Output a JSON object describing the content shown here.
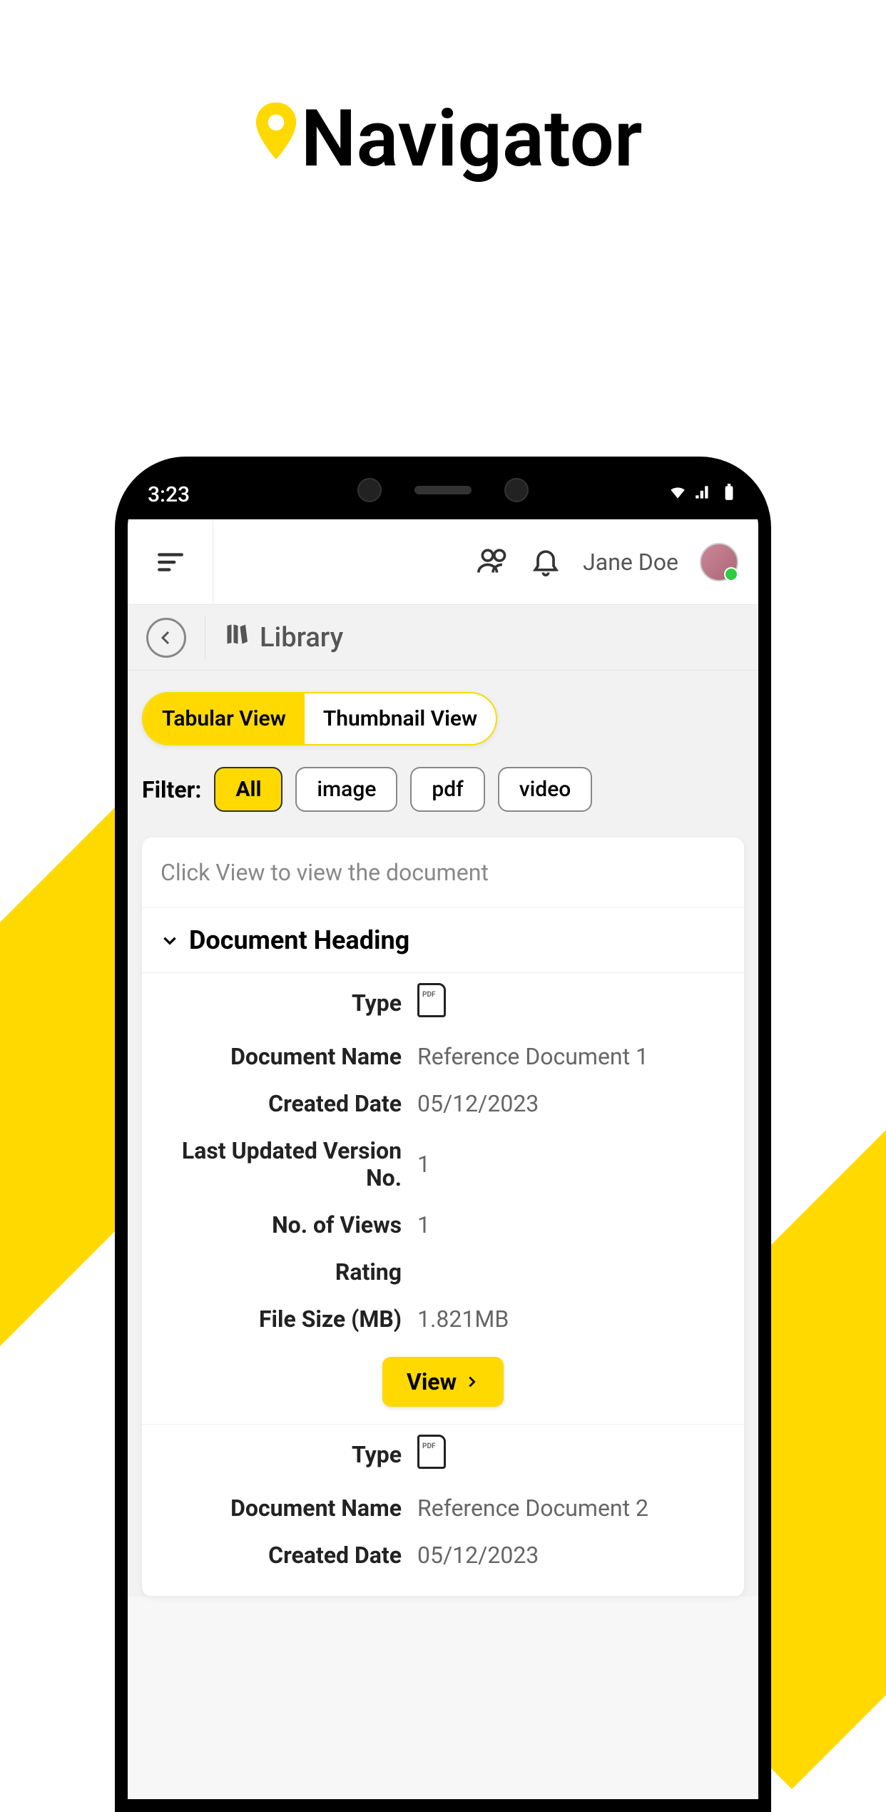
{
  "logo": {
    "text": "Navigator"
  },
  "status": {
    "time": "3:23"
  },
  "header": {
    "user": "Jane Doe"
  },
  "crumb": {
    "title": "Library"
  },
  "view_toggle": {
    "tabular": "Tabular View",
    "thumbnail": "Thumbnail View"
  },
  "filter": {
    "label": "Filter:",
    "options": [
      "All",
      "image",
      "pdf",
      "video"
    ],
    "active": "All"
  },
  "card": {
    "hint": "Click View to view the document",
    "heading": "Document Heading",
    "labels": {
      "type": "Type",
      "name": "Document Name",
      "created": "Created Date",
      "version": "Last Updated Version No.",
      "views": "No. of Views",
      "rating": "Rating",
      "size": "File Size (MB)"
    },
    "view_btn": "View",
    "docs": [
      {
        "name": "Reference Document 1",
        "created": "05/12/2023",
        "version": "1",
        "views": "1",
        "rating": "",
        "size": "1.821MB"
      },
      {
        "name": "Reference Document 2",
        "created": "05/12/2023"
      }
    ]
  }
}
